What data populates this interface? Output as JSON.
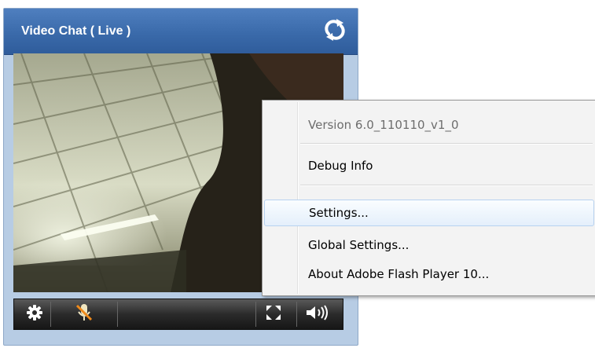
{
  "widget": {
    "title": "Video Chat ( Live )",
    "refresh_icon": "refresh-icon"
  },
  "video": {
    "content": "webcam-feed"
  },
  "controls": {
    "settings_icon": "gear-icon",
    "mic_icon": "microphone-muted-icon",
    "fullscreen_icon": "fullscreen-icon",
    "volume_icon": "speaker-volume-icon"
  },
  "context_menu": {
    "version_label": "Version 6.0_110110_v1_0",
    "debug_label": "Debug Info",
    "settings_label": "Settings...",
    "global_settings_label": "Global Settings...",
    "about_label": "About Adobe Flash Player 10..."
  },
  "colors": {
    "titlebar": "#3a6aaa",
    "panel": "#b7cce4",
    "menu_bg": "#f3f3f3",
    "menu_highlight": "#e4effb"
  }
}
